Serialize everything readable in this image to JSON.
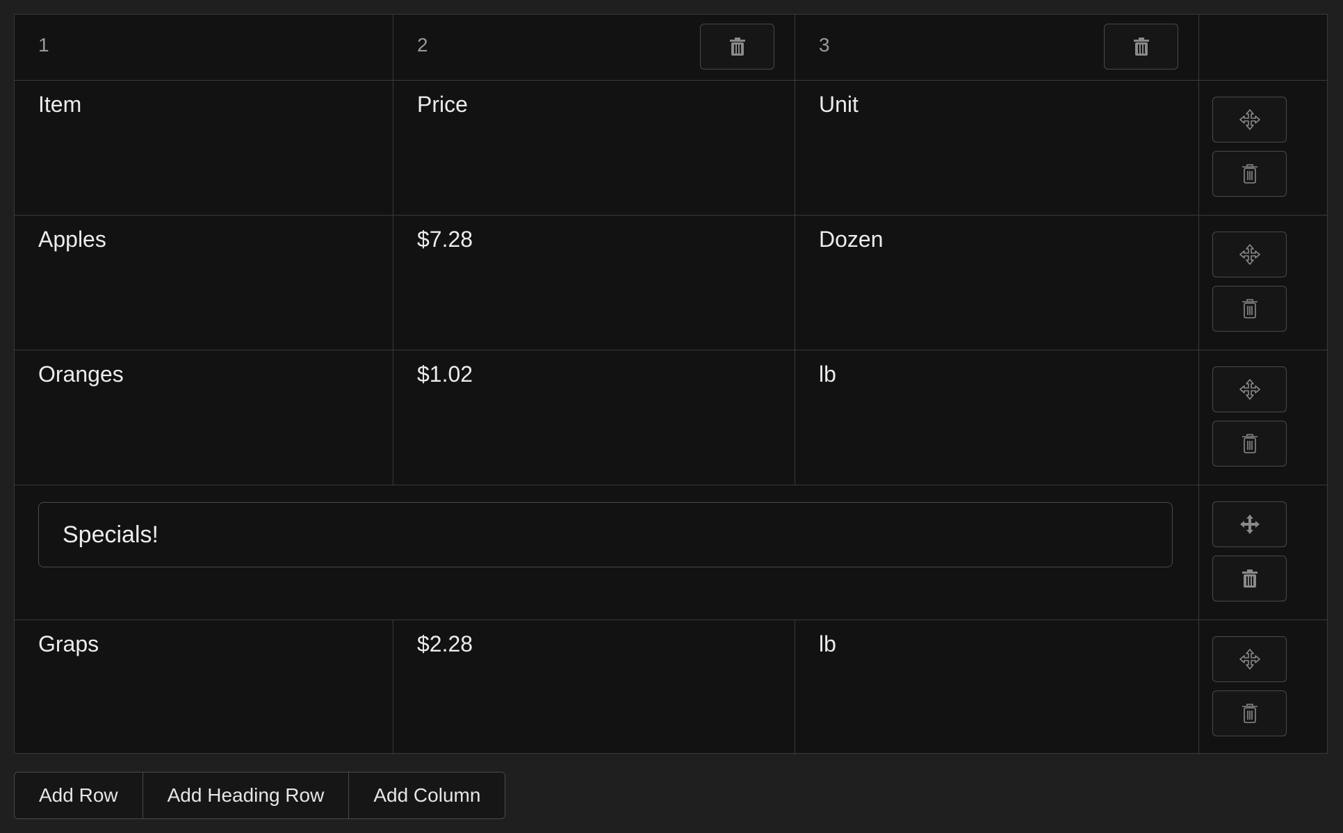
{
  "columns": [
    {
      "number": "1"
    },
    {
      "number": "2"
    },
    {
      "number": "3"
    }
  ],
  "rows": [
    {
      "type": "row",
      "cells": [
        "Item",
        "Price",
        "Unit"
      ]
    },
    {
      "type": "row",
      "cells": [
        "Apples",
        "$7.28",
        "Dozen"
      ]
    },
    {
      "type": "row",
      "cells": [
        "Oranges",
        "$1.02",
        "lb"
      ]
    },
    {
      "type": "heading",
      "value": "Specials!"
    },
    {
      "type": "row",
      "cells": [
        "Graps",
        "$2.28",
        "lb"
      ]
    }
  ],
  "actions": {
    "add_row": "Add Row",
    "add_heading_row": "Add Heading Row",
    "add_column": "Add Column"
  },
  "icons": {
    "move": "move-icon",
    "delete": "trash-icon"
  },
  "colors": {
    "page_bg": "#1f1f1f",
    "table_bg": "#121212",
    "border": "#3a3a3a",
    "text": "#ececec",
    "muted": "#9a9a9a"
  }
}
